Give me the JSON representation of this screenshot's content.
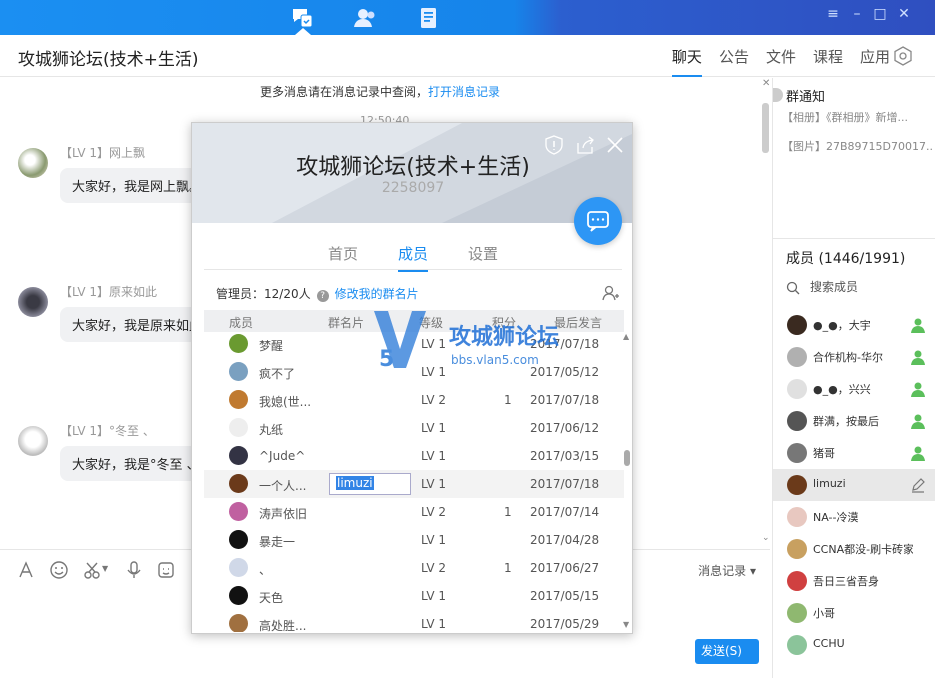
{
  "header": {
    "title": "攻城狮论坛(技术+生活)",
    "tabs": [
      "聊天",
      "公告",
      "文件",
      "课程",
      "应用"
    ]
  },
  "chat": {
    "more_text": "更多消息请在消息记录中查阅，",
    "more_link": "打开消息记录",
    "time": "12:50:40",
    "messages": [
      {
        "name": "【LV 1】网上飘",
        "text": "大家好，我是网上飘。"
      },
      {
        "name": "【LV 1】原来如此",
        "text": "大家好，我是原来如此"
      },
      {
        "name": "【LV 1】°冬至 、",
        "text": "大家好，我是°冬至 、"
      }
    ]
  },
  "toolbar": {
    "history": "消息记录",
    "send": "发送(S)"
  },
  "right": {
    "notice_title": "群通知",
    "notices": [
      "【相册】《群相册》新增...",
      "【图片】27B89715D70017..."
    ],
    "members_title": "成员 (1446/1991)",
    "search": "搜索成员",
    "members": [
      {
        "name": "●_●，大宇",
        "color": "#3a2a20",
        "admin": true
      },
      {
        "name": "合作机构-华尔",
        "color": "#b0b0b0",
        "admin": true
      },
      {
        "name": "●_●，兴兴",
        "color": "#e0e0e0",
        "admin": true
      },
      {
        "name": "群满，按最后",
        "color": "#555",
        "admin": true
      },
      {
        "name": "猪哥",
        "color": "#777",
        "admin": true
      },
      {
        "name": "limuzi",
        "color": "#6b3a1a",
        "admin": false
      },
      {
        "name": "NA--冷漠",
        "color": "#e8c8c0",
        "admin": false
      },
      {
        "name": "CCNA都没-刷卡砖家",
        "color": "#c8a060",
        "admin": false
      },
      {
        "name": "吾日三省吾身",
        "color": "#d04040",
        "admin": false
      },
      {
        "name": "小哥",
        "color": "#8fb870",
        "admin": false
      },
      {
        "name": "CCHU",
        "color": "#8bc49a",
        "admin": false
      }
    ]
  },
  "card": {
    "group_name": "攻城狮论坛(技术+生活)",
    "group_num": "2258097",
    "tabs": [
      "首页",
      "成员",
      "设置"
    ],
    "admin_label": "管理员：12/20人",
    "admin_link": "修改我的群名片",
    "columns": [
      "成员",
      "群名片",
      "等级",
      "积分",
      "最后发言"
    ],
    "rows": [
      {
        "name": "梦醒",
        "card": "",
        "level": "LV 1",
        "points": "",
        "date": "2017/07/18",
        "color": "#6a9a30"
      },
      {
        "name": "疯不了",
        "card": "",
        "level": "LV 1",
        "points": "",
        "date": "2017/05/12",
        "color": "#7aa0c0"
      },
      {
        "name": "我媳(世...",
        "card": "",
        "level": "LV 2",
        "points": "1",
        "date": "2017/07/18",
        "color": "#c07a30"
      },
      {
        "name": "丸纸",
        "card": "",
        "level": "LV 1",
        "points": "",
        "date": "2017/06/12",
        "color": "#eeeeee"
      },
      {
        "name": "^Jude^",
        "card": "",
        "level": "LV 1",
        "points": "",
        "date": "2017/03/15",
        "color": "#333344"
      },
      {
        "name": "一个人...",
        "card": "limuzi",
        "level": "LV 1",
        "points": "",
        "date": "2017/07/18",
        "color": "#6b3a1a"
      },
      {
        "name": "涛声依旧",
        "card": "",
        "level": "LV 2",
        "points": "1",
        "date": "2017/07/14",
        "color": "#c060a0"
      },
      {
        "name": "暴走一",
        "card": "",
        "level": "LV 1",
        "points": "",
        "date": "2017/04/28",
        "color": "#111111"
      },
      {
        "name": "、",
        "card": "",
        "level": "LV 2",
        "points": "1",
        "date": "2017/06/27",
        "color": "#d0d8e8"
      },
      {
        "name": "天色",
        "card": "",
        "level": "LV 1",
        "points": "",
        "date": "2017/05/15",
        "color": "#111111"
      },
      {
        "name": "高处胜...",
        "card": "",
        "level": "LV 1",
        "points": "",
        "date": "2017/05/29",
        "color": "#a07040"
      }
    ]
  },
  "watermark": {
    "big": "攻城狮论坛",
    "small": "bbs.vlan5.com"
  }
}
